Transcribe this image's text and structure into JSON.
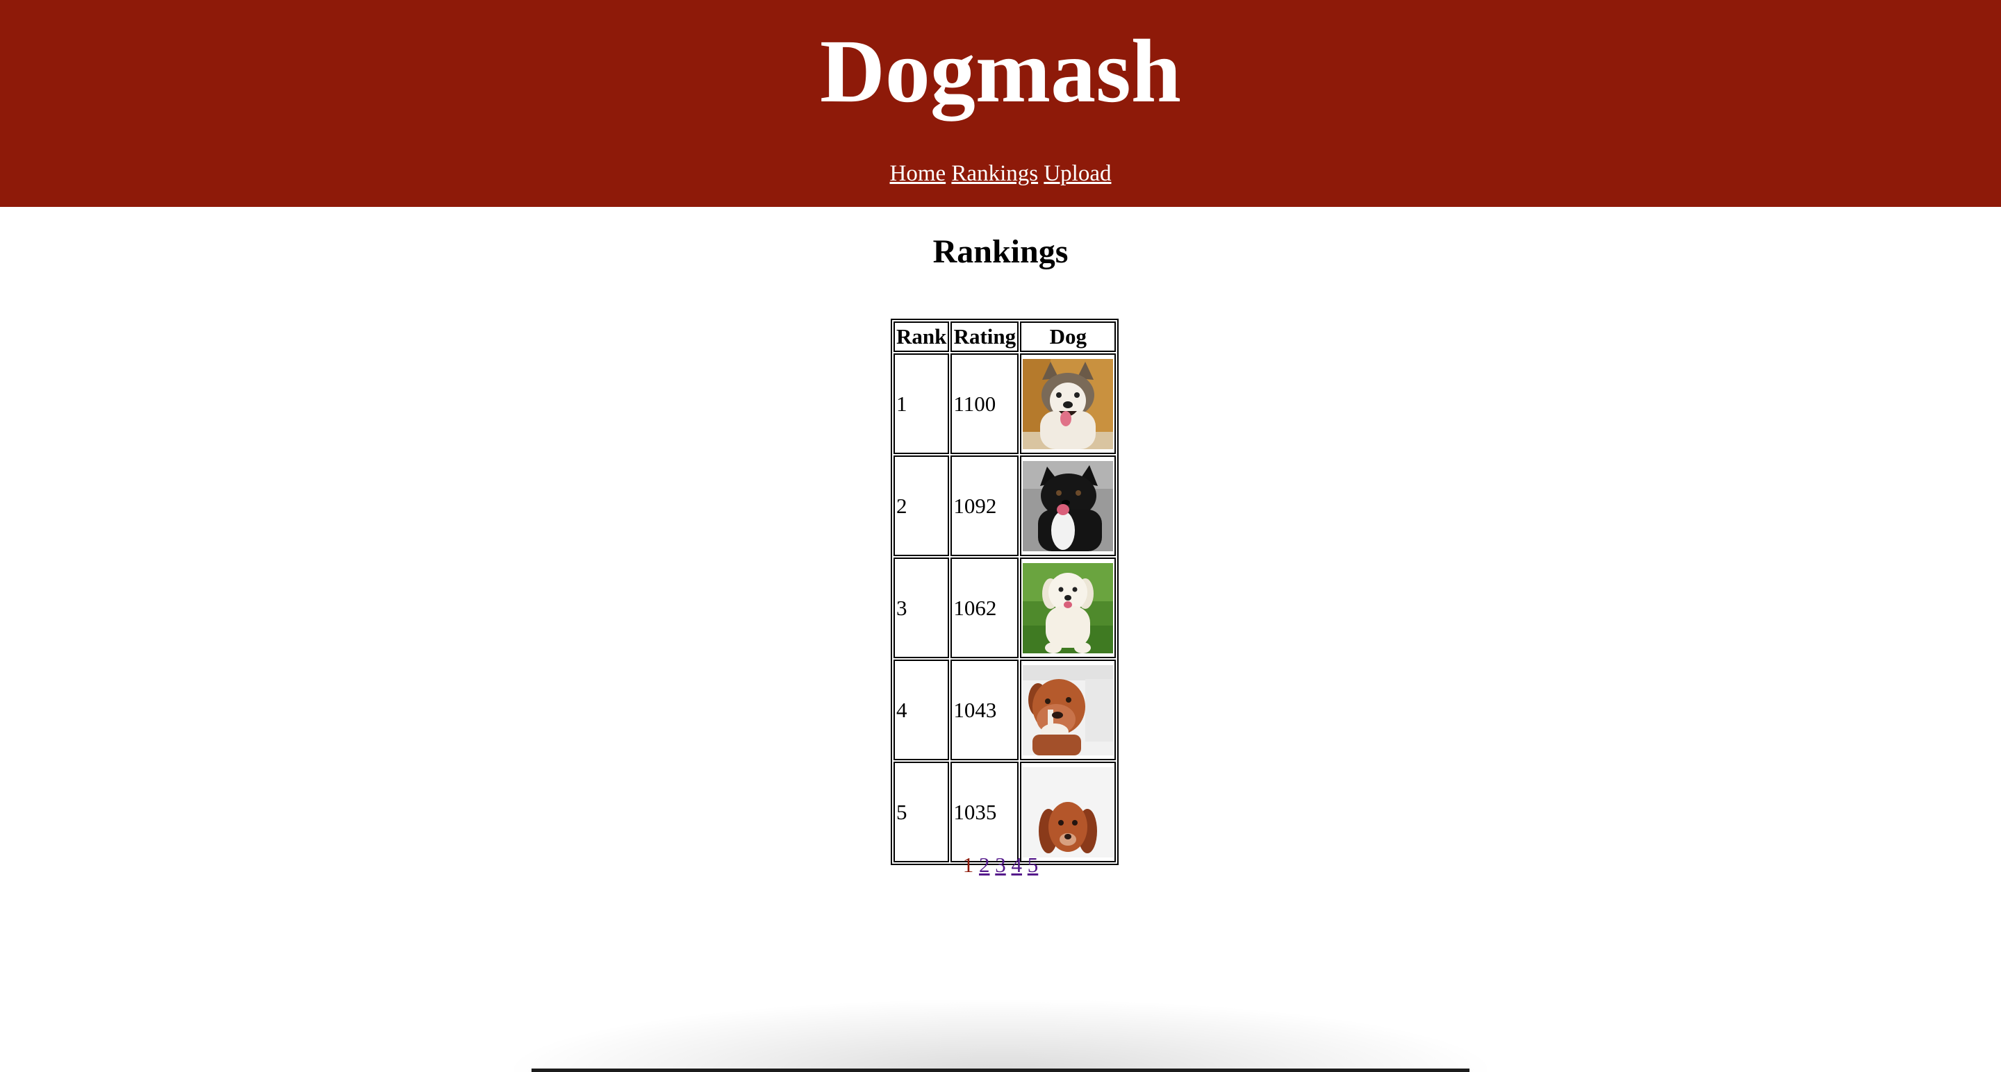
{
  "site": {
    "title": "Dogmash",
    "header_color": "#8e1a09"
  },
  "nav": {
    "items": [
      {
        "label": "Home"
      },
      {
        "label": "Rankings"
      },
      {
        "label": "Upload"
      }
    ]
  },
  "main": {
    "heading": "Rankings",
    "table": {
      "columns": [
        "Rank",
        "Rating",
        "Dog"
      ],
      "rows": [
        {
          "rank": "1",
          "rating": "1100",
          "dog_image": "husky-photo"
        },
        {
          "rank": "2",
          "rating": "1092",
          "dog_image": "black-border-collie-photo"
        },
        {
          "rank": "3",
          "rating": "1062",
          "dog_image": "white-golden-retriever-photo"
        },
        {
          "rank": "4",
          "rating": "1043",
          "dog_image": "boxer-photo"
        },
        {
          "rank": "5",
          "rating": "1035",
          "dog_image": "dachshund-photo"
        }
      ]
    },
    "pagination": {
      "current": "1",
      "pages": [
        "2",
        "3",
        "4",
        "5"
      ]
    }
  }
}
